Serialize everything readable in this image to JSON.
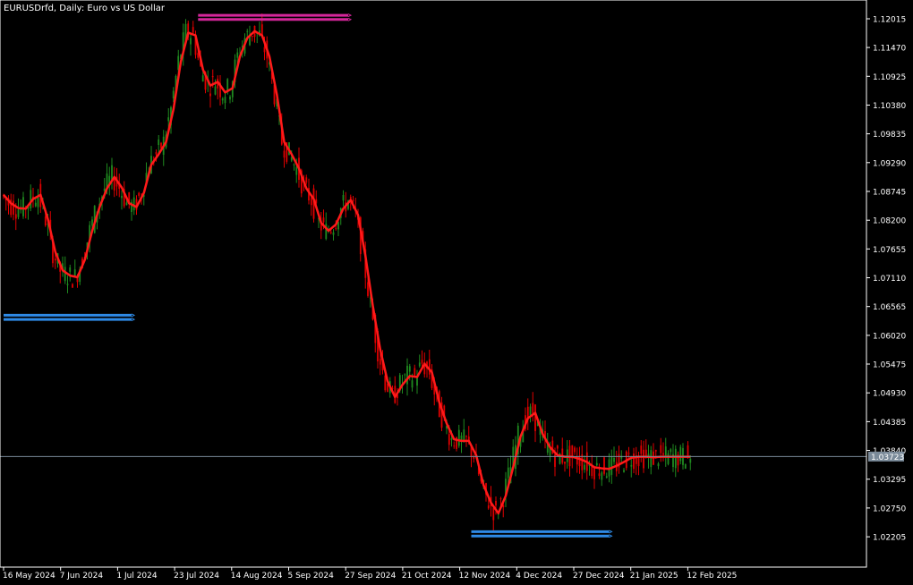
{
  "window": {
    "title": "EURUSDrfd, Daily:  Euro vs US Dollar"
  },
  "colors": {
    "background": "#000000",
    "axis": "#ffffff",
    "bull_candle": "#1f8a1f",
    "bear_candle": "#e00000",
    "ma_line": "#ff1a1a",
    "resistance_zone": "#d4269a",
    "support_zone": "#2e8ae6",
    "current_price_line": "#7a8a99",
    "price_box": "#7a8a99"
  },
  "current_price": {
    "label": "1.03723",
    "value": 1.03723
  },
  "chart_data": {
    "type": "line",
    "symbol": "EURUSDrfd",
    "timeframe": "Daily",
    "title": "EURUSDrfd, Daily:  Euro vs US Dollar",
    "ylim": [
      1.0163,
      1.1237
    ],
    "y_ticks": [
      "1.12015",
      "1.11470",
      "1.10925",
      "1.10380",
      "1.09835",
      "1.09290",
      "1.08745",
      "1.08200",
      "1.07655",
      "1.07110",
      "1.06565",
      "1.06020",
      "1.05475",
      "1.04930",
      "1.04385",
      "1.03840",
      "1.03295",
      "1.02750",
      "1.02205"
    ],
    "x_ticks": [
      "16 May 2024",
      "7 Jun 2024",
      "1 Jul 2024",
      "23 Jul 2024",
      "14 Aug 2024",
      "5 Sep 2024",
      "27 Sep 2024",
      "21 Oct 2024",
      "12 Nov 2024",
      "4 Dec 2024",
      "27 Dec 2024",
      "21 Jan 2025",
      "12 Feb 2025"
    ],
    "series": [
      {
        "kind": "moving_average",
        "x": [
          0,
          3,
          6,
          9,
          12,
          15,
          18,
          21,
          24,
          27,
          30,
          33,
          36,
          39,
          42,
          45,
          48,
          51,
          54,
          57,
          60,
          63,
          66,
          69,
          72,
          75,
          78,
          81,
          84,
          87,
          90,
          93,
          96,
          99,
          102,
          105,
          108,
          111,
          114,
          117,
          120,
          123,
          126,
          129,
          132,
          135,
          138,
          141,
          144,
          147,
          150,
          153,
          156,
          159,
          162,
          165,
          168,
          171,
          174,
          177,
          180,
          183,
          186,
          189,
          192,
          195,
          198,
          201,
          204,
          207,
          210,
          213,
          216,
          219,
          222,
          225,
          228,
          231,
          234,
          237,
          240,
          243,
          246,
          249,
          252,
          255,
          258,
          261,
          264,
          267,
          270,
          273,
          276,
          279
        ],
        "values": [
          1.0868,
          1.0852,
          1.0843,
          1.0842,
          1.086,
          1.0868,
          1.0822,
          1.076,
          1.0725,
          1.0715,
          1.0712,
          1.0745,
          1.08,
          1.0845,
          1.088,
          1.0902,
          1.0882,
          1.0852,
          1.0845,
          1.0872,
          1.0925,
          1.0945,
          1.0968,
          1.103,
          1.112,
          1.1175,
          1.117,
          1.1105,
          1.1075,
          1.1082,
          1.1062,
          1.107,
          1.113,
          1.1165,
          1.1178,
          1.117,
          1.113,
          1.1058,
          1.0968,
          1.0945,
          1.0918,
          1.088,
          1.086,
          1.0815,
          1.08,
          1.0812,
          1.0842,
          1.0858,
          1.083,
          1.0752,
          1.0658,
          1.0575,
          1.0515,
          1.0485,
          1.0508,
          1.0525,
          1.0523,
          1.0548,
          1.0532,
          1.0475,
          1.0435,
          1.0405,
          1.0402,
          1.0402,
          1.0375,
          1.0318,
          1.0285,
          1.0265,
          1.0298,
          1.0352,
          1.041,
          1.0445,
          1.0455,
          1.0415,
          1.039,
          1.0375,
          1.0372,
          1.0372,
          1.0368,
          1.0362,
          1.0352,
          1.035,
          1.0349,
          1.0355,
          1.0362,
          1.037,
          1.0372,
          1.0372,
          1.0371,
          1.0372,
          1.0372,
          1.0372,
          1.0372,
          1.0372
        ]
      }
    ],
    "zones": [
      {
        "name": "resistance",
        "y": [
          1.1208,
          1.12
        ],
        "from_day": 79,
        "to_day": 140,
        "color": "#d4269a"
      },
      {
        "name": "support_old",
        "y": [
          1.064,
          1.0632
        ],
        "from_day": 0,
        "to_day": 52,
        "color": "#2e8ae6"
      },
      {
        "name": "support",
        "y": [
          1.023,
          1.0222
        ],
        "from_day": 190,
        "to_day": 246,
        "color": "#2e8ae6"
      }
    ]
  }
}
